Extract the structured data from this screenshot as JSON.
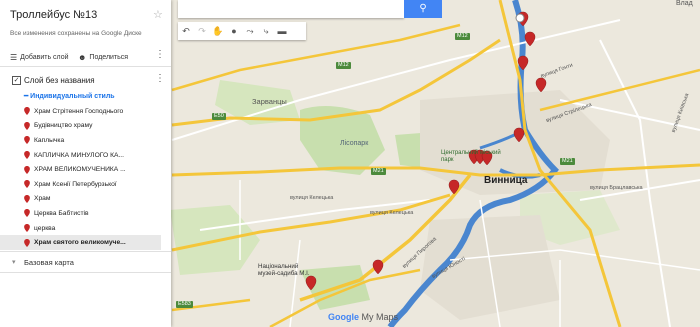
{
  "panel": {
    "title": "Троллейбус №13",
    "saved_note": "Все изменения сохранены на Google Диске",
    "add_layer": "Добавить слой",
    "share": "Поделиться",
    "layer_name": "Слой без названия",
    "style": "Индивидуальный стиль",
    "places": [
      "Храм Стрітення Господнього",
      "Будівництво храму",
      "Каплычка",
      "КАПЛИЧКА МИНУЛОГО КА...",
      "ХРАМ ВЕЛИКОМУЧЕНИКА ...",
      "Храм Ксенії Петербурзької",
      "Храм",
      "Церква Бабтистів",
      "церква",
      "Храм святого великомуче..."
    ],
    "base_map": "Базовая карта"
  },
  "map_labels": {
    "city": "Винница",
    "zarvantsy": "Зарванцы",
    "lisopark": "Лісопарк",
    "central_park": "Центральний міський парк",
    "museum": "Національний музей-садиба М.І.",
    "vlad": "Влад",
    "kelecka1": "вулиця Келецька",
    "kelecka2": "вулиця Келецька",
    "pirogova": "вулиця Пирогова",
    "stroytelna": "вулиця Стрілецька",
    "hetmanska": "вулиця Гонти",
    "brats": "вулиця Брацлавська",
    "kyivska": "вулиця Київська",
    "yunosti": "вулиця Юності",
    "m12a": "M12",
    "m12b": "M12",
    "m21": "M21",
    "m21b": "M21",
    "e50": "E50",
    "e583": "E583"
  },
  "footer": {
    "brand": "Google",
    "product": "My Maps"
  },
  "colors": {
    "pin": "#c62828",
    "search_button": "#4285f4",
    "road_major": "#f7cf3c",
    "river": "#3f7ec8"
  }
}
